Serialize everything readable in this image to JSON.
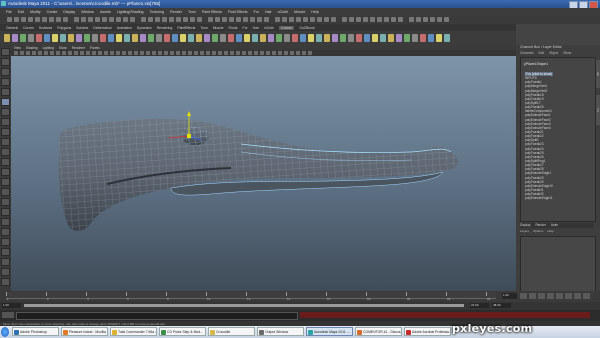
{
  "window": {
    "title": "Autodesk Maya 2011 - C:\\users\\...\\scenes\\crocodile.mb* --- pPlane1.vtx[765]"
  },
  "menubar": {
    "items": [
      "File",
      "Edit",
      "Modify",
      "Create",
      "Display",
      "Window",
      "Assets",
      "Lighting/Shading",
      "Texturing",
      "Render",
      "Toon",
      "Paint Effects",
      "Fluid Effects",
      "Fur",
      "Hair",
      "nCloth",
      "Muscle",
      "Help"
    ]
  },
  "shelf": {
    "tabs": [
      "General",
      "Curves",
      "Surfaces",
      "Polygons",
      "Subdivs",
      "Deformation",
      "Animation",
      "Dynamics",
      "Rendering",
      "PaintEffects",
      "Toon",
      "Muscle",
      "Fluids",
      "Fur",
      "Hair",
      "nCloth",
      "Custom",
      "GoZBrush"
    ],
    "active_tab": "Custom"
  },
  "panel": {
    "menus": [
      "View",
      "Shading",
      "Lighting",
      "Show",
      "Renderer",
      "Panels"
    ]
  },
  "channel_box": {
    "title": "Channel Box / Layer Editor",
    "menus": [
      "Channels",
      "Edit",
      "Object",
      "Show"
    ],
    "object_name": "pPlane1Shape1",
    "history_items": [
      "CVs (click to show)",
      "INPUTS",
      "polyTweak1",
      "polyMergeVert1",
      "polyMergeVert2",
      "polyTweak18",
      "polyTweak19",
      "polySplit17",
      "polyTweak20",
      "deleteComponent1",
      "polyExtrudeFace1",
      "polyExtrudeFace2",
      "polyExtrudeFace3",
      "polyExtrudeFace4",
      "polyTweak21",
      "polyTweak22",
      "polySplit1",
      "polyTweak23",
      "polyTweak24",
      "polyTweak25",
      "polyTweak26",
      "polySplitRing1",
      "polyTweak27",
      "polyTweak28",
      "polyExtrudeEdge1",
      "polyTweak29",
      "polyTweak30",
      "polyExtrudeEdge10",
      "polyTweak31",
      "polyTweak32",
      "polyExtrudeEdge11"
    ],
    "selected_index": 0
  },
  "layer_editor": {
    "tabs": [
      "Display",
      "Render",
      "Anim"
    ],
    "menus": [
      "Layers",
      "Options",
      "Help"
    ]
  },
  "timeline": {
    "ticks": [
      "1",
      "2",
      "4",
      "6",
      "8",
      "10",
      "12",
      "14",
      "16",
      "18",
      "20",
      "22",
      "24"
    ],
    "current_frame": "1.00",
    "start": "1.00",
    "end": "24.00",
    "range_end": "48.00"
  },
  "help_line": "Move Tool: Use manipulator to move object(s). Use edit mode to change pivot (INSERT). Ctrl+LMB to move perpendicular.",
  "taskbar": {
    "buttons": [
      {
        "label": "Adobe Photoshop",
        "color": "#2f6fb3"
      },
      {
        "label": "Pleasure Island - Mozilla F...",
        "color": "#e07a24"
      },
      {
        "label": "Total Commander 7.56a - ...",
        "color": "#e0b030"
      },
      {
        "label": "CG Pulse Step & Mod...",
        "color": "#3a8f4a"
      },
      {
        "label": "Crocodile",
        "color": "#d7b84a"
      },
      {
        "label": "Output Window",
        "color": "#6a6a6a"
      },
      {
        "label": "Autodesk Maya 2011 -...",
        "color": "#2aa4a4"
      },
      {
        "label": "CGMENTOR #1 - Discus...",
        "color": "#d36b2a"
      },
      {
        "label": "Adobe Acrobat Professio...",
        "color": "#c62a2a"
      }
    ],
    "active_index": 6
  },
  "watermark": "pxleyes.com"
}
